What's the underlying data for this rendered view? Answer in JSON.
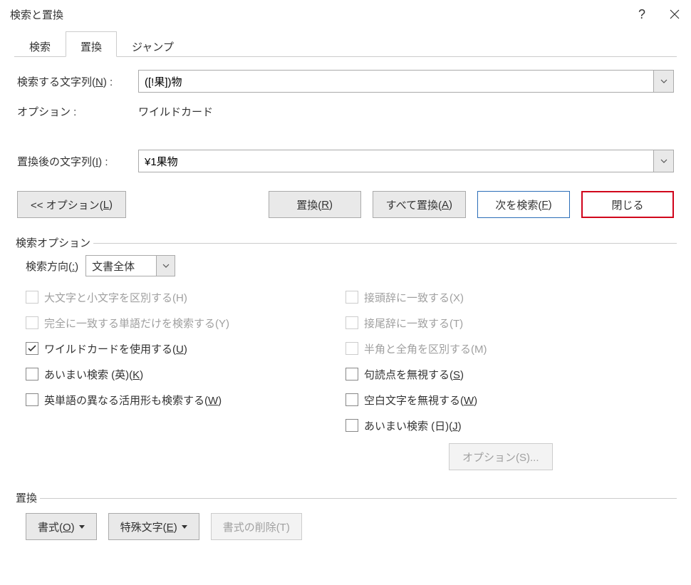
{
  "title": "検索と置換",
  "tabs": {
    "search": "検索",
    "replace": "置換",
    "jump": "ジャンプ"
  },
  "labels": {
    "find_what": "検索する文字列(N) :",
    "options": "オプション :",
    "options_value": "ワイルドカード",
    "replace_with": "置換後の文字列(I) :"
  },
  "fields": {
    "find_value": "([!果])物",
    "replace_value": "¥1果物"
  },
  "buttons": {
    "less_options": "<< オプション(L)",
    "replace": "置換(R)",
    "replace_all": "すべて置換(A)",
    "find_next": "次を検索(F)",
    "close": "閉じる"
  },
  "search_options": {
    "title": "検索オプション",
    "direction_label": "検索方向(:)",
    "direction_value": "文書全体",
    "left": {
      "match_case": "大文字と小文字を区別する(H)",
      "whole_word": "完全に一致する単語だけを検索する(Y)",
      "wildcards": "ワイルドカードを使用する(U)",
      "sounds_like_en": "あいまい検索 (英)(K)",
      "word_forms": "英単語の異なる活用形も検索する(W)"
    },
    "right": {
      "prefix": "接頭辞に一致する(X)",
      "suffix": "接尾辞に一致する(T)",
      "half_full": "半角と全角を区別する(M)",
      "ignore_punct": "句読点を無視する(S)",
      "ignore_space": "空白文字を無視する(W)",
      "sounds_like_jp": "あいまい検索 (日)(J)"
    },
    "option_btn": "オプション(S)..."
  },
  "replace_section": {
    "title": "置換",
    "format": "書式(O)",
    "special": "特殊文字(E)",
    "no_format": "書式の削除(T)"
  }
}
